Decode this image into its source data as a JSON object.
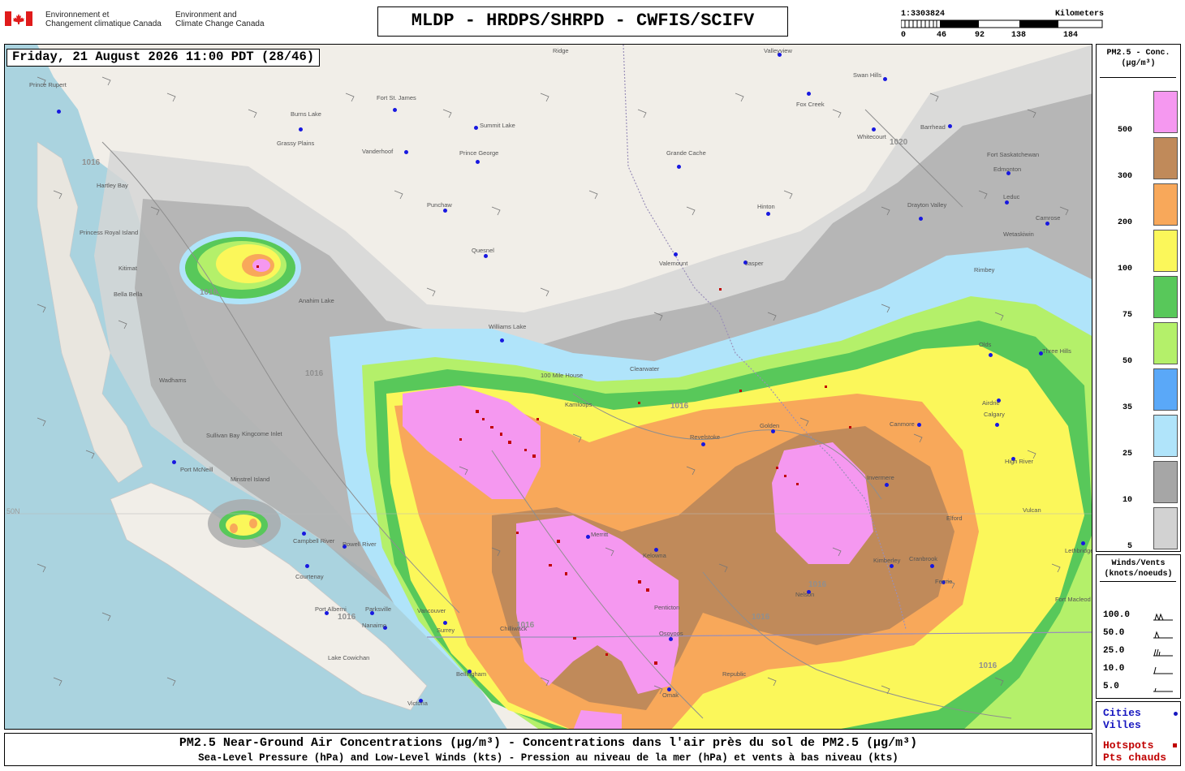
{
  "header": {
    "agency_fr_line1": "Environnement et",
    "agency_fr_line2": "Changement climatique Canada",
    "agency_en_line1": "Environment and",
    "agency_en_line2": "Climate Change Canada",
    "title": "MLDP - HRDPS/SHRPD - CWFIS/SCIFV"
  },
  "scale": {
    "ratio": "1:3303824",
    "unit": "Kilometers",
    "ticks": [
      "0",
      "46",
      "92",
      "138",
      "184"
    ]
  },
  "timestamp": "Friday, 21 August 2026 11:00 PDT (28/46)",
  "concentration_legend": {
    "title_line1": "PM2.5 - Conc.",
    "title_line2": "(µg/m³)",
    "levels": [
      {
        "label": "500",
        "color": "#f598f0"
      },
      {
        "label": "300",
        "color": "#c08a5a"
      },
      {
        "label": "200",
        "color": "#f8a85a"
      },
      {
        "label": "100",
        "color": "#fbf75a"
      },
      {
        "label": "75",
        "color": "#58c85a"
      },
      {
        "label": "50",
        "color": "#b4f06a"
      },
      {
        "label": "35",
        "color": "#5aa8f8"
      },
      {
        "label": "25",
        "color": "#b0e4fa"
      },
      {
        "label": "10",
        "color": "#a6a6a6"
      },
      {
        "label": "5",
        "color": "#d2d2d2"
      }
    ]
  },
  "wind_legend": {
    "title_line1": "Winds/Vents",
    "title_line2": "(knots/noeuds)",
    "speeds": [
      "100.0",
      "50.0",
      "25.0",
      "10.0",
      "5.0"
    ]
  },
  "point_legend": {
    "cities_en": "Cities",
    "cities_fr": "Villes",
    "hotspots_en": "Hotspots",
    "hotspots_fr": "Pts chauds",
    "city_color": "#1818c0",
    "hotspot_color": "#c00000"
  },
  "footer": {
    "line1": "PM2.5 Near-Ground Air Concentrations (µg/m³) - Concentrations dans l'air près du sol de PM2.5 (µg/m³)",
    "line2": "Sea-Level Pressure (hPa) and Low-Level Winds (kts) - Pression au niveau de la mer (hPa) et vents à bas niveau (kts)"
  },
  "map": {
    "cities": [
      "Prince Rupert",
      "Burns Lake",
      "Fort St. James",
      "Summit Lake",
      "Prince George",
      "Vanderhoof",
      "Grassy Plains",
      "Grande Cache",
      "Whitecourt",
      "Barrhead",
      "Swan Hills",
      "Fox Creek",
      "Valleyview",
      "Ridge",
      "Hartley Bay",
      "Princess Royal Island",
      "Kitimat",
      "Bella Bella",
      "Punchaw",
      "Quesnel",
      "Hinton",
      "Valemount",
      "Jasper",
      "Edmonton",
      "Fort Saskatchewan",
      "Leduc",
      "Camrose",
      "Wetaskiwin",
      "Drayton Valley",
      "Rimbey",
      "Olds",
      "Three Hills",
      "Airdrie",
      "Calgary",
      "High River",
      "Canmore",
      "Invermere",
      "Cranbrook",
      "Fernie",
      "Kimberley",
      "Nelson",
      "Golden",
      "Revelstoke",
      "Kelowna",
      "Merritt",
      "Osoyoos",
      "Omak",
      "Williams Lake",
      "100 Mile House",
      "Wadhams",
      "Sullivan Bay",
      "Kingcome Inlet",
      "Port McNeill",
      "Minstrel Island",
      "Campbell River",
      "Courtenay",
      "Powell River",
      "Port Alberni",
      "Parksville",
      "Nanaimo",
      "Vancouver",
      "Surrey",
      "Bellingham",
      "Lake Cowichan",
      "Victoria",
      "Chilliwack",
      "Lethbridge",
      "Fort Macleod",
      "Vulcan",
      "Elford",
      "Republic",
      "Penticton",
      "Kamloops",
      "Clearwater",
      "Anahim Lake"
    ],
    "isobar_value": "1016",
    "isobar_value_high": "1020",
    "lat_label": "50N"
  }
}
